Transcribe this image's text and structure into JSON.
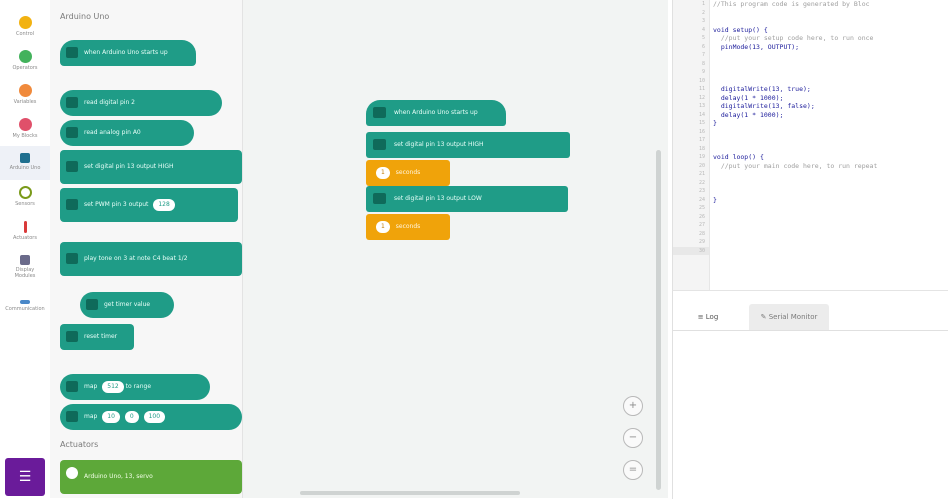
{
  "rail": {
    "categories": [
      {
        "label": "Control",
        "color": "#f2b211"
      },
      {
        "label": "Operators",
        "color": "#43b25c"
      },
      {
        "label": "Variables",
        "color": "#f08a3c"
      },
      {
        "label": "My Blocks",
        "color": "#e0506a"
      },
      {
        "label": "Arduino Uno",
        "color": "#1f6f8f"
      },
      {
        "label": "Sensors",
        "color": "#7a9a1a"
      },
      {
        "label": "Actuators",
        "color": "#d93a3a"
      },
      {
        "label": "Display Modules",
        "color": "#6a6a8a"
      },
      {
        "label": "Communication",
        "color": "#4a88c8"
      }
    ],
    "bottom_icon": "extension-icon"
  },
  "flyout": {
    "section1_title": "Arduino Uno",
    "section2_title": "Actuators",
    "blocks": [
      {
        "text": "when Arduino Uno starts up"
      },
      {
        "text": "read digital pin 2"
      },
      {
        "text": "read analog pin A0"
      },
      {
        "text": "set digital pin 13 output HIGH"
      },
      {
        "text": "set PWM pin 3 output",
        "num": "128"
      },
      {
        "text": "play tone on 3 at note C4 beat 1/2"
      },
      {
        "text": "get timer value"
      },
      {
        "text": "reset timer"
      },
      {
        "text": "map",
        "num": "512",
        "tail": "to range"
      },
      {
        "text": "map",
        "num": "10",
        "num2": "0",
        "num3": "100"
      },
      {
        "text": "Arduino Uno, 13, servo"
      }
    ]
  },
  "workspace": {
    "blocks": [
      {
        "type": "hat",
        "text": "when Arduino Uno starts up"
      },
      {
        "type": "cmd",
        "text": "set digital pin 13 output HIGH"
      },
      {
        "type": "wait",
        "num": "1",
        "text": "seconds"
      },
      {
        "type": "cmd",
        "text": "set digital pin 13 output LOW"
      },
      {
        "type": "wait",
        "num": "1",
        "text": "seconds"
      }
    ],
    "controls": [
      "zoom-in-icon",
      "zoom-out-icon",
      "reset-zoom-icon"
    ]
  },
  "editor": {
    "lines": [
      {
        "n": "1",
        "t": "//This program code is generated by Bloc",
        "k": "comment"
      },
      {
        "n": "2",
        "t": "",
        "k": "plain"
      },
      {
        "n": "3",
        "t": "",
        "k": "plain"
      },
      {
        "n": "4",
        "t": "void setup() {",
        "k": "code"
      },
      {
        "n": "5",
        "t": "  //put your setup code here, to run once",
        "k": "comment"
      },
      {
        "n": "6",
        "t": "  pinMode(13, OUTPUT);",
        "k": "code"
      },
      {
        "n": "7",
        "t": "",
        "k": "plain"
      },
      {
        "n": "8",
        "t": "",
        "k": "plain"
      },
      {
        "n": "9",
        "t": "",
        "k": "plain"
      },
      {
        "n": "10",
        "t": "",
        "k": "plain"
      },
      {
        "n": "11",
        "t": "  digitalWrite(13, true);",
        "k": "code"
      },
      {
        "n": "12",
        "t": "  delay(1 * 1000);",
        "k": "code"
      },
      {
        "n": "13",
        "t": "  digitalWrite(13, false);",
        "k": "code"
      },
      {
        "n": "14",
        "t": "  delay(1 * 1000);",
        "k": "code"
      },
      {
        "n": "15",
        "t": "}",
        "k": "code"
      },
      {
        "n": "16",
        "t": "",
        "k": "plain"
      },
      {
        "n": "17",
        "t": "",
        "k": "plain"
      },
      {
        "n": "18",
        "t": "",
        "k": "plain"
      },
      {
        "n": "19",
        "t": "void loop() {",
        "k": "code"
      },
      {
        "n": "20",
        "t": "  //put your main code here, to run repeat",
        "k": "comment"
      },
      {
        "n": "21",
        "t": "",
        "k": "plain"
      },
      {
        "n": "22",
        "t": "",
        "k": "plain"
      },
      {
        "n": "23",
        "t": "",
        "k": "plain"
      },
      {
        "n": "24",
        "t": "}",
        "k": "code"
      },
      {
        "n": "25",
        "t": "",
        "k": "plain"
      },
      {
        "n": "26",
        "t": "",
        "k": "plain"
      },
      {
        "n": "27",
        "t": "",
        "k": "plain"
      },
      {
        "n": "28",
        "t": "",
        "k": "plain"
      },
      {
        "n": "29",
        "t": "",
        "k": "plain"
      },
      {
        "n": "30",
        "t": "",
        "k": "plain"
      }
    ]
  },
  "log": {
    "tab_active": "Log",
    "tab_inactive": "Serial Monitor"
  }
}
